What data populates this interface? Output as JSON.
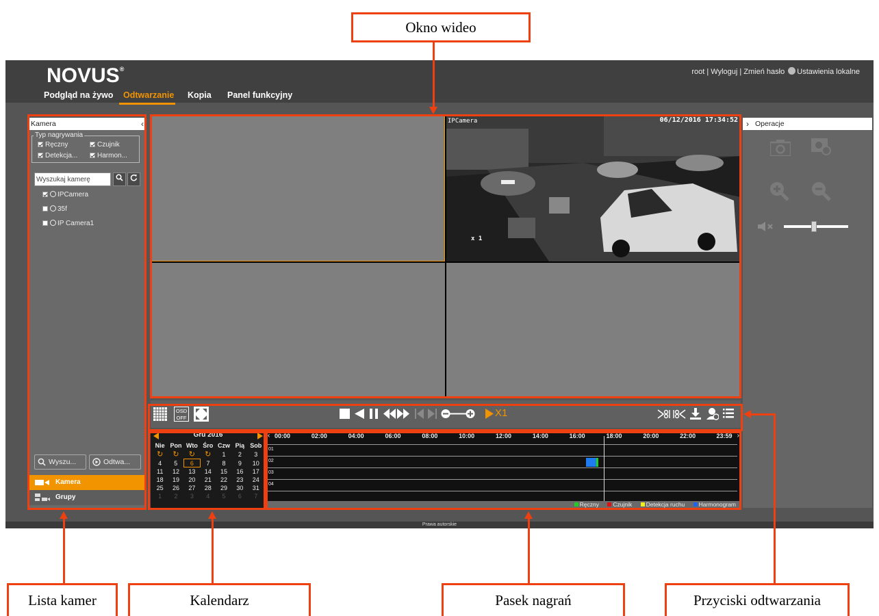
{
  "app": {
    "brand": "NOVUS",
    "brand_mark": "®",
    "tabs": [
      {
        "label": "Podgląd na żywo",
        "active": false
      },
      {
        "label": "Odtwarzanie",
        "active": true
      },
      {
        "label": "Kopia",
        "active": false
      },
      {
        "label": "Panel funkcyjny",
        "active": false
      }
    ],
    "user_links": {
      "user": "root",
      "logout": "Wyloguj",
      "change_password": "Zmień hasło",
      "local_settings": "Ustawienia lokalne",
      "separator": "|"
    },
    "accent_color": "#f29400",
    "footer": "Prawa autorskie"
  },
  "sidebar": {
    "title": "Kamera",
    "recording_type_legend": "Typ nagrywania",
    "recording_types": [
      {
        "label": "Ręczny",
        "checked": true
      },
      {
        "label": "Czujnik",
        "checked": true
      },
      {
        "label": "Detekcja...",
        "checked": true
      },
      {
        "label": "Harmon...",
        "checked": true
      }
    ],
    "search_placeholder": "Wyszukaj kamerę",
    "cameras": [
      {
        "label": "IPCamera",
        "checked": true
      },
      {
        "label": "35f",
        "checked": false
      },
      {
        "label": "IP Camera1",
        "checked": false
      }
    ],
    "search_button": "Wyszu...",
    "play_button": "Odtwa...",
    "nav": [
      {
        "label": "Kamera",
        "active": true
      },
      {
        "label": "Grupy",
        "active": false
      }
    ]
  },
  "video": {
    "channel_name": "IPCamera",
    "osd_datetime": "06/12/2016 17:34:52",
    "osd_speed": "x 1"
  },
  "controls": {
    "osd_label_top": "OSD",
    "osd_label_bottom": "OFF",
    "speed": "X1"
  },
  "operations": {
    "title": "Operacje"
  },
  "calendar": {
    "month_label": "Gru  2016",
    "weekdays": [
      "Nie",
      "Pon",
      "Wto",
      "Śro",
      "Czw",
      "Pią",
      "Sob"
    ],
    "weeks": [
      [
        "",
        "",
        "",
        "",
        "1",
        "2",
        "3"
      ],
      [
        "4",
        "5",
        "6",
        "7",
        "8",
        "9",
        "10"
      ],
      [
        "11",
        "12",
        "13",
        "14",
        "15",
        "16",
        "17"
      ],
      [
        "18",
        "19",
        "20",
        "21",
        "22",
        "23",
        "24"
      ],
      [
        "25",
        "26",
        "27",
        "28",
        "29",
        "30",
        "31"
      ],
      [
        "1",
        "2",
        "3",
        "4",
        "5",
        "6",
        "7"
      ]
    ],
    "selected_day": "6"
  },
  "timeline": {
    "hours": [
      "00:00",
      "02:00",
      "04:00",
      "06:00",
      "08:00",
      "10:00",
      "12:00",
      "14:00",
      "16:00",
      "18:00",
      "20:00",
      "22:00",
      "23:59"
    ],
    "cursor_time": "17:34:52",
    "channels": [
      "01",
      "02",
      "03",
      "04"
    ],
    "recording_segment": {
      "channel": "02",
      "start_hour": 16.9,
      "end_hour": 17.58,
      "type_color": "#1e7cf0"
    },
    "legend": [
      {
        "label": "Ręczny",
        "color": "#22cc22"
      },
      {
        "label": "Czujnik",
        "color": "#dd1111"
      },
      {
        "label": "Detekcja ruchu",
        "color": "#eeee22"
      },
      {
        "label": "Harmonogram",
        "color": "#1e64f0"
      }
    ]
  },
  "callouts": {
    "video_window": "Okno wideo",
    "camera_list": "Lista kamer",
    "calendar": "Kalendarz",
    "recording_bar": "Pasek nagrań",
    "playback_buttons": "Przyciski odtwarzania"
  },
  "callout_color": "#ee4010"
}
